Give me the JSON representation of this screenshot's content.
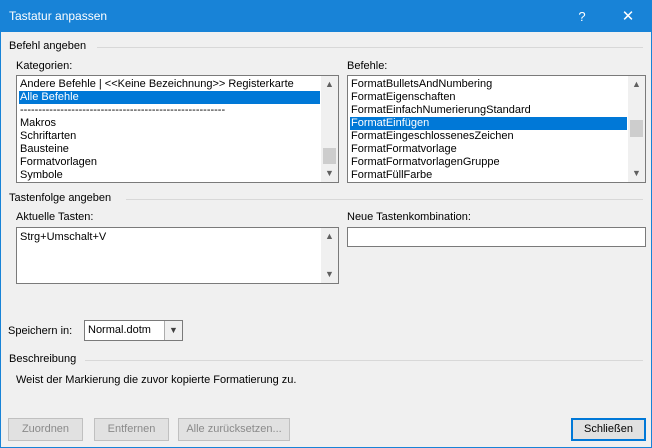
{
  "window": {
    "title": "Tastatur anpassen",
    "help_icon": "?",
    "close_icon": "✕"
  },
  "befehl": {
    "group_label": "Befehl angeben",
    "kategorien_label": "Kategorien:",
    "kategorien": [
      {
        "label": "Andere Befehle | <<Keine Bezeichnung>> Registerkarte",
        "selected": false
      },
      {
        "label": "Alle Befehle",
        "selected": true
      },
      {
        "label": "--------------------------------------------------------",
        "selected": false
      },
      {
        "label": "Makros",
        "selected": false
      },
      {
        "label": "Schriftarten",
        "selected": false
      },
      {
        "label": "Bausteine",
        "selected": false
      },
      {
        "label": "Formatvorlagen",
        "selected": false
      },
      {
        "label": "Symbole",
        "selected": false
      }
    ],
    "befehle_label": "Befehle:",
    "befehle": [
      {
        "label": "FormatBulletsAndNumbering",
        "selected": false
      },
      {
        "label": "FormatEigenschaften",
        "selected": false
      },
      {
        "label": "FormatEinfachNumerierungStandard",
        "selected": false
      },
      {
        "label": "FormatEinfügen",
        "selected": true
      },
      {
        "label": "FormatEingeschlossenesZeichen",
        "selected": false
      },
      {
        "label": "FormatFormatvorlage",
        "selected": false
      },
      {
        "label": "FormatFormatvorlagenGruppe",
        "selected": false
      },
      {
        "label": "FormatFüllFarbe",
        "selected": false
      }
    ]
  },
  "tastenfolge": {
    "group_label": "Tastenfolge angeben",
    "aktuelle_label": "Aktuelle Tasten:",
    "aktuelle_tasten": "Strg+Umschalt+V",
    "neue_label": "Neue Tastenkombination:",
    "neue_value": ""
  },
  "speichern": {
    "label": "Speichern in:",
    "value": "Normal.dotm"
  },
  "beschreibung": {
    "group_label": "Beschreibung",
    "text": "Weist der Markierung die zuvor kopierte Formatierung zu."
  },
  "buttons": {
    "zuordnen": "Zuordnen",
    "entfernen": "Entfernen",
    "alle_zuruecksetzen": "Alle zurücksetzen...",
    "schliessen": "Schließen"
  },
  "colors": {
    "titlebar": "#1883d7",
    "selection": "#0078d7"
  }
}
